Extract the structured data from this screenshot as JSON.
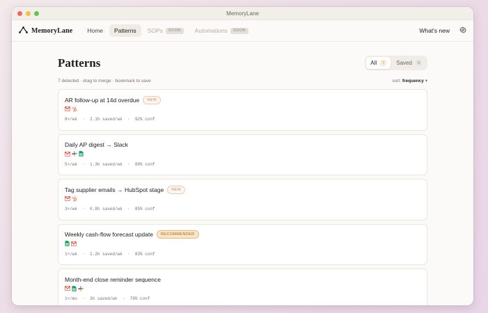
{
  "window": {
    "title": "MemoryLane"
  },
  "nav": {
    "brand": "MemoryLane",
    "items": [
      {
        "label": "Home"
      },
      {
        "label": "Patterns"
      },
      {
        "label": "SOPs",
        "badge": "SOON"
      },
      {
        "label": "Automations",
        "badge": "SOON"
      }
    ],
    "whats_new": "What's new"
  },
  "page": {
    "title": "Patterns",
    "filters": [
      {
        "label": "All",
        "count": "7"
      },
      {
        "label": "Saved",
        "count": "0"
      }
    ],
    "meta": "7 detected · drag to merge · bookmark to save",
    "sort_prefix": "sort:",
    "sort_value": "frequency",
    "sort_caret": "▾"
  },
  "cards": [
    {
      "title": "AR follow-up at 14d overdue",
      "badge": "NEW",
      "apps": [
        "gmail",
        "hubspot"
      ],
      "stats": "8×/wk  ·  2.1h saved/wk  ·  92% conf"
    },
    {
      "title": "Daily AP digest → Slack",
      "badge": "",
      "apps": [
        "gmail",
        "slack",
        "sheets"
      ],
      "stats": "5×/wk  ·  1.3h saved/wk  ·  88% conf"
    },
    {
      "title": "Tag supplier emails → HubSpot stage",
      "badge": "NEW",
      "apps": [
        "gmail",
        "hubspot"
      ],
      "stats": "3×/wk  ·  0.8h saved/wk  ·  85% conf"
    },
    {
      "title": "Weekly cash-flow forecast update",
      "badge": "RECOMMENDED",
      "apps": [
        "sheets",
        "gmail"
      ],
      "stats": "1×/wk  ·  1.2h saved/wk  ·  83% conf"
    },
    {
      "title": "Month-end close reminder sequence",
      "badge": "",
      "apps": [
        "gmail",
        "sheets",
        "slack"
      ],
      "stats": "1×/mo  ·  3h saved/wk  ·  79% conf"
    }
  ],
  "colors": {
    "accent": "#c48f52",
    "new": "#d38456",
    "recommended": "#fbe6c7"
  }
}
